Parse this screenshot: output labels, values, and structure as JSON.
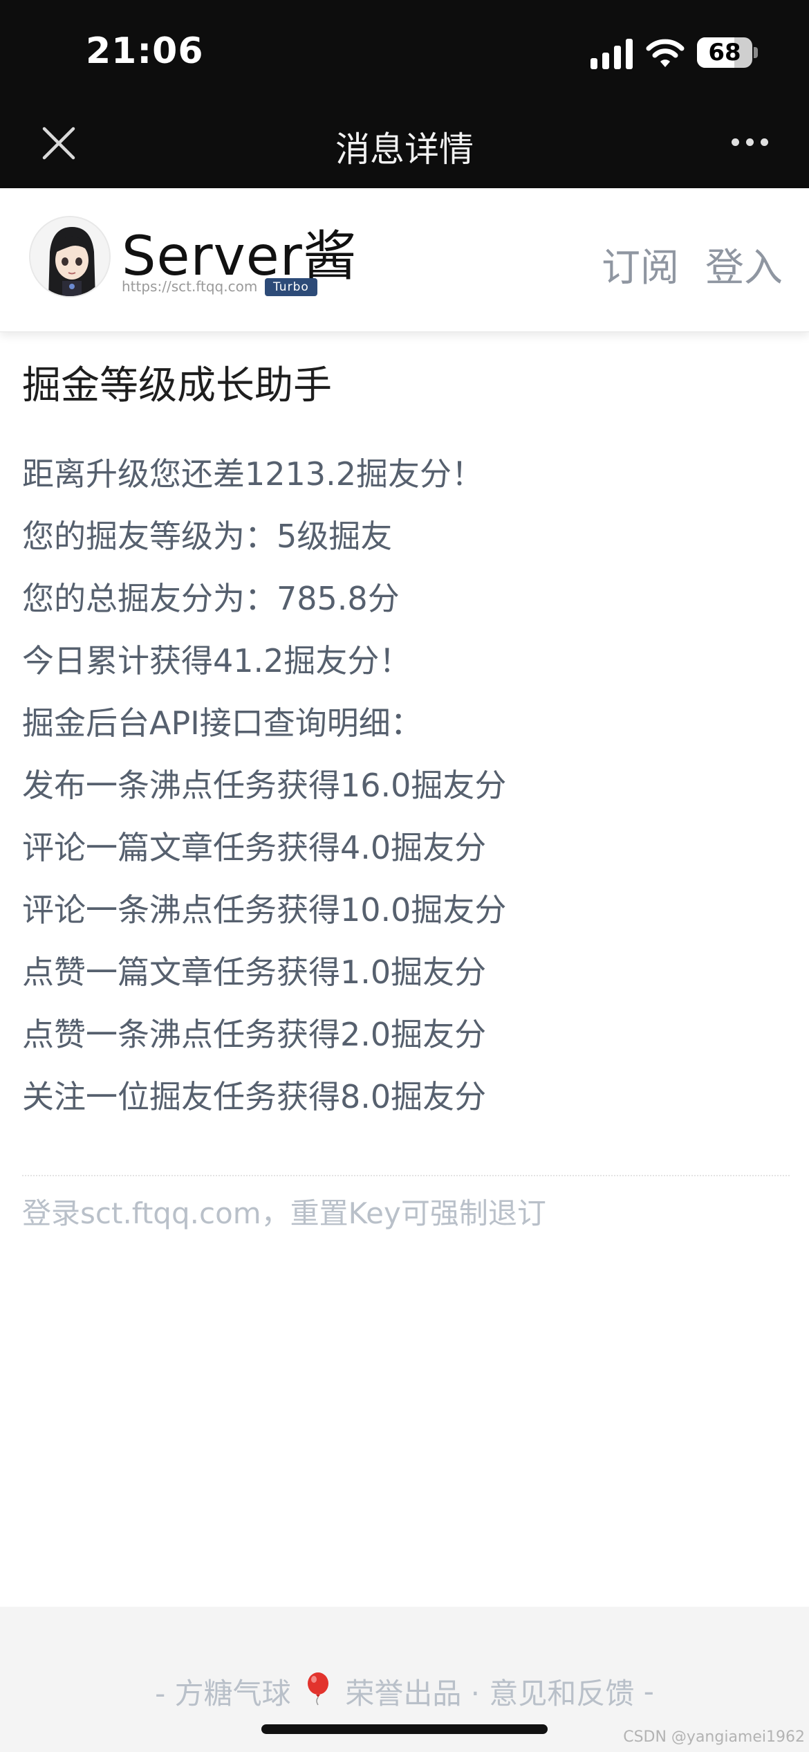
{
  "status_bar": {
    "time": "21:06",
    "battery": "68",
    "battery_level": 0.68
  },
  "nav": {
    "title": "消息详情"
  },
  "site": {
    "name": "Server酱",
    "url": "https://sct.ftqq.com",
    "badge": "Turbo",
    "subscribe_label": "订阅",
    "login_label": "登入"
  },
  "message": {
    "title": "掘金等级成长助手",
    "lines": [
      "距离升级您还差1213.2掘友分！",
      "您的掘友等级为：5级掘友",
      "您的总掘友分为：785.8分",
      "今日累计获得41.2掘友分！",
      "掘金后台API接口查询明细：",
      "发布一条沸点任务获得16.0掘友分",
      "评论一篇文章任务获得4.0掘友分",
      "评论一条沸点任务获得10.0掘友分",
      "点赞一篇文章任务获得1.0掘友分",
      "点赞一条沸点任务获得2.0掘友分",
      "关注一位掘友任务获得8.0掘友分"
    ],
    "unsubscribe_note": "登录sct.ftqq.com，重置Key可强制退订"
  },
  "footer": {
    "prefix": "- 方糖气球",
    "middle": "荣誉出品 ·",
    "feedback": "意见和反馈",
    "suffix": "-",
    "balloon_icon": "balloon-icon"
  },
  "watermark": "CSDN @yangiamei1962",
  "colors": {
    "nav_bg": "#0d0d0d",
    "badge": "#2d4b78",
    "text": "#56606e",
    "muted": "#b9c0c9"
  }
}
